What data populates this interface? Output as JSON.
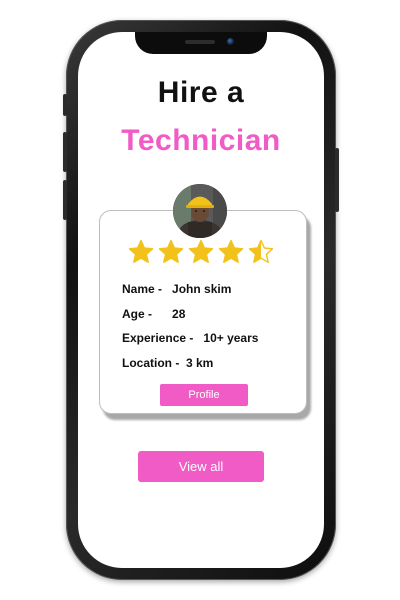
{
  "header": {
    "title_line1": "Hire a",
    "title_line2": "Technician"
  },
  "card": {
    "rating": 4.5,
    "rating_max": 5,
    "details": [
      {
        "label": "Name -",
        "value": "John skim"
      },
      {
        "label": "Age -",
        "value": "28"
      },
      {
        "label": "Experience -",
        "value": "10+ years"
      },
      {
        "label": "Location -",
        "value": "3 km"
      }
    ],
    "profile_button": "Profile"
  },
  "actions": {
    "view_all": "View all"
  },
  "colors": {
    "accent": "#f15bc6",
    "star": "#f2c21b",
    "title": "#111111"
  },
  "icons": {
    "avatar": "technician-avatar",
    "rating": "star-icon"
  }
}
